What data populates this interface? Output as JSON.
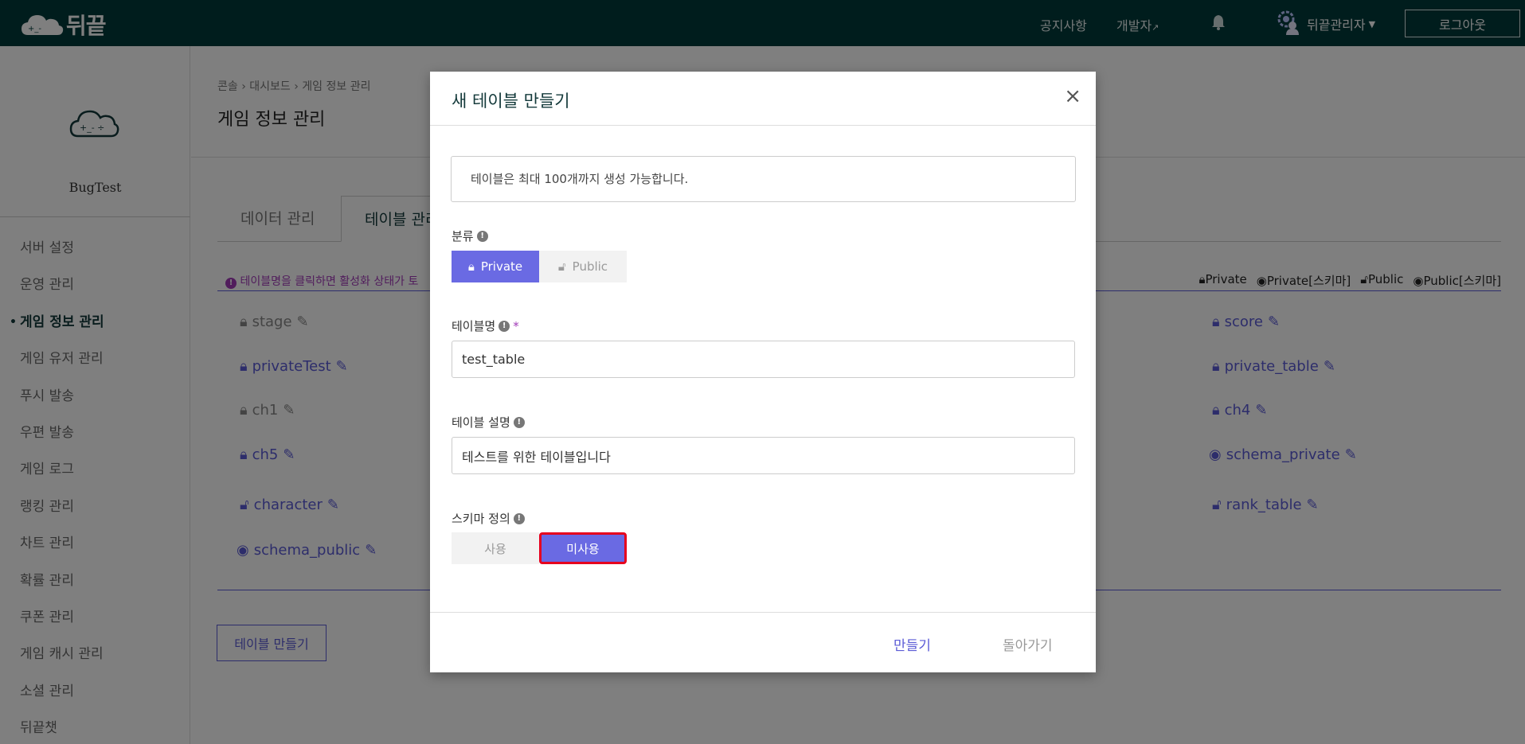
{
  "topbar": {
    "logo_text": "뒤끝",
    "nav": {
      "notice": "공지사항",
      "developer": "개발자"
    },
    "admin_name": "뒤끝관리자",
    "logout": "로그아웃"
  },
  "sidebar": {
    "project_name": "BugTest",
    "items": [
      {
        "label": "서버 설정"
      },
      {
        "label": "운영 관리"
      },
      {
        "label": "게임 정보 관리"
      },
      {
        "label": "게임 유저 관리"
      },
      {
        "label": "푸시 발송"
      },
      {
        "label": "우편 발송"
      },
      {
        "label": "게임 로그"
      },
      {
        "label": "랭킹 관리"
      },
      {
        "label": "차트 관리"
      },
      {
        "label": "확률 관리"
      },
      {
        "label": "쿠폰 관리"
      },
      {
        "label": "게임 캐시 관리"
      },
      {
        "label": "소셜 관리"
      },
      {
        "label": "뒤끝챗"
      }
    ],
    "active_index": 2
  },
  "main": {
    "breadcrumb": "콘솔 › 대시보드 › 게임 정보 관리",
    "title": "게임 정보 관리",
    "tabs": [
      {
        "label": "데이터 관리"
      },
      {
        "label": "테이블 관리"
      }
    ],
    "info_text": "테이블명을 클릭하면 활성화 상태가 토",
    "legend": {
      "private": "Private",
      "private_schema": "Private[스키마]",
      "public": "Public",
      "public_schema": "Public[스키마]"
    },
    "tables_left": [
      {
        "name": "stage"
      },
      {
        "name": "privateTest"
      },
      {
        "name": "ch1"
      },
      {
        "name": "ch5"
      },
      {
        "name": "character"
      },
      {
        "name": "schema_public"
      }
    ],
    "tables_right": [
      {
        "name": "score"
      },
      {
        "name": "private_table"
      },
      {
        "name": "ch4"
      },
      {
        "name": "schema_private"
      },
      {
        "name": "rank_table"
      }
    ],
    "create_button": "테이블 만들기"
  },
  "modal": {
    "title": "새 테이블 만들기",
    "close": "×",
    "notice": "테이블은 최대 100개까지 생성 가능합니다.",
    "category_label": "분류",
    "category_options": {
      "private": "Private",
      "public": "Public"
    },
    "category_selected": "Private",
    "table_name_label": "테이블명",
    "required_mark": "*",
    "table_name_value": "test_table",
    "description_label": "테이블 설명",
    "description_value": "테스트를 위한 테이블입니다",
    "schema_label": "스키마 정의",
    "schema_options": {
      "use": "사용",
      "not_use": "미사용"
    },
    "schema_selected": "미사용",
    "footer": {
      "create": "만들기",
      "back": "돌아가기"
    }
  },
  "colors": {
    "topbar": "#013a3a",
    "accent": "#6a6ae3",
    "link": "#5b5bd6",
    "focus_border": "#e6001e"
  }
}
